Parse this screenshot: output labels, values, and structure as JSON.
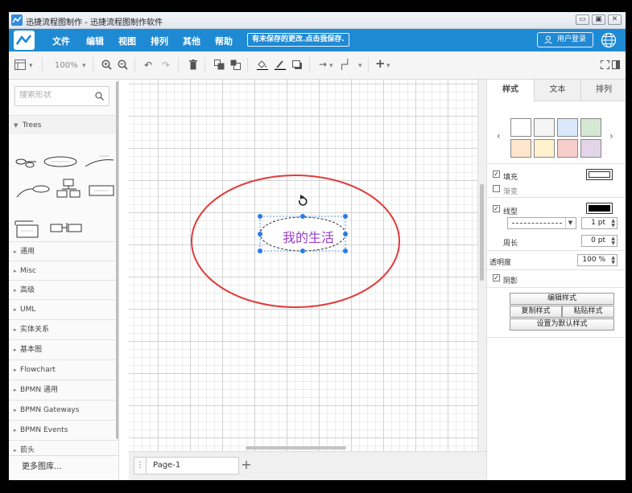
{
  "window": {
    "title": "迅捷流程图制作 - 迅捷流程图制作软件",
    "controls": [
      "minimize",
      "maximize",
      "close"
    ]
  },
  "menubar": {
    "items": [
      "文件",
      "编辑",
      "视图",
      "排列",
      "其他",
      "帮助"
    ],
    "unsaved_notice": "有未保存的更改.点击我保存.",
    "login": "用户登录"
  },
  "toolbar": {
    "zoom": "100%"
  },
  "sidebar": {
    "search_placeholder": "搜索形状",
    "trees_label": "Trees",
    "sections": [
      "通用",
      "Misc",
      "高级",
      "UML",
      "实体关系",
      "基本图",
      "Flowchart",
      "BPMN 通用",
      "BPMN Gateways",
      "BPMN Events",
      "箭头"
    ],
    "more_libraries": "更多图库..."
  },
  "canvas": {
    "shape_text": "我的生活",
    "shape_text_color": "#9a3dc7",
    "big_ellipse_color": "#e03c3c",
    "handle_color": "#2a7be4"
  },
  "pages": {
    "current": "Page-1"
  },
  "panel": {
    "tabs": [
      "样式",
      "文本",
      "排列"
    ],
    "swatches": [
      "#ffffff",
      "#f5f5f5",
      "#dae8fc",
      "#d5e8d4",
      "#ffe6cc",
      "#fff2cc",
      "#f8cecc",
      "#e1d5e7"
    ],
    "fill_label": "填充",
    "gradient_label": "渐变",
    "line_label": "线型",
    "line_color": "#000000",
    "line_width": "1 pt",
    "perimeter_label": "周长",
    "perimeter_value": "0 pt",
    "opacity_label": "透明度",
    "opacity_value": "100 %",
    "shadow_label": "阴影",
    "edit_style": "编辑样式",
    "copy_style": "复制样式",
    "paste_style": "粘贴样式",
    "set_default": "设置为默认样式"
  }
}
